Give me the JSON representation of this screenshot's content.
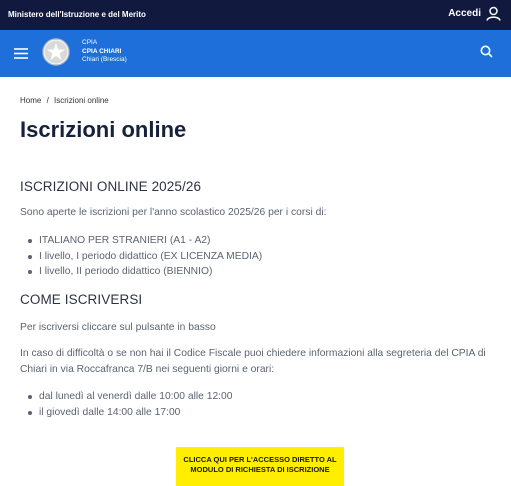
{
  "topbar": {
    "ministry": "Ministero dell'Istruzione e del Merito",
    "login_label": "Accedi"
  },
  "header": {
    "school_line1": "CPIA",
    "school_name": "CPIA CHIARI",
    "school_city": "Chiari (Brescia)",
    "icons": [
      "menu-icon",
      "emblem-icon",
      "search-icon"
    ]
  },
  "breadcrumb": {
    "home": "Home",
    "separator": "/",
    "current": "Iscrizioni online"
  },
  "page": {
    "title": "Iscrizioni online"
  },
  "content": {
    "heading1": "ISCRIZIONI ONLINE 2025/26",
    "intro": "Sono aperte le iscrizioni per l'anno scolastico 2025/26 per i corsi di:",
    "courses": [
      "ITALIANO PER STRANIERI (A1 - A2)",
      "I livello, I periodo didattico (EX LICENZA MEDIA)",
      "I livello, II periodo didattico (BIENNIO)"
    ],
    "heading2": "COME ISCRIVERSI",
    "how_to": "Per iscriversi cliccare sul pulsante in basso",
    "difficulty": "In caso di difficoltà o se non hai il Codice Fiscale puoi chiedere informazioni alla segreteria del CPIA di Chiari in via Roccafranca 7/B nei seguenti giorni e orari:",
    "hours": [
      "dal lunedì al venerdì dalle 10:00 alle 12:00",
      "il giovedì dalle 14:00 alle 17:00"
    ],
    "cta_line1": "CLICCA QUI PER L'ACCESSO DIRETTO AL",
    "cta_line2": "MODULO DI RICHIESTA DI ISCRIZIONE"
  },
  "colors": {
    "topbar": "#111a3e",
    "header": "#1e6fd9",
    "cta": "#ffee00"
  }
}
